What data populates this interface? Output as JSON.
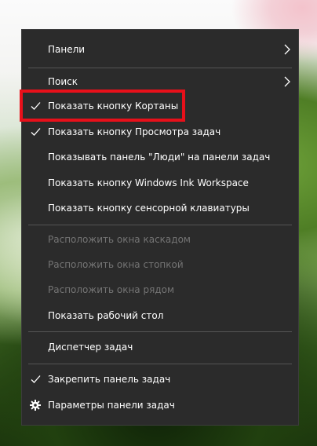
{
  "menu": {
    "items": [
      {
        "label": "Панели",
        "checked": false,
        "submenu": true,
        "disabled": false
      },
      {
        "label": "Поиск",
        "checked": false,
        "submenu": true,
        "disabled": false
      },
      {
        "label": "Показать кнопку Кортаны",
        "checked": true,
        "submenu": false,
        "disabled": false
      },
      {
        "label": "Показать кнопку Просмотра задач",
        "checked": true,
        "submenu": false,
        "disabled": false
      },
      {
        "label": "Показывать панель \"Люди\" на панели задач",
        "checked": false,
        "submenu": false,
        "disabled": false
      },
      {
        "label": "Показать кнопку Windows Ink Workspace",
        "checked": false,
        "submenu": false,
        "disabled": false
      },
      {
        "label": "Показать кнопку сенсорной клавиатуры",
        "checked": false,
        "submenu": false,
        "disabled": false
      },
      {
        "label": "Расположить окна каскадом",
        "checked": false,
        "submenu": false,
        "disabled": true
      },
      {
        "label": "Расположить окна стопкой",
        "checked": false,
        "submenu": false,
        "disabled": true
      },
      {
        "label": "Расположить окна рядом",
        "checked": false,
        "submenu": false,
        "disabled": true
      },
      {
        "label": "Показать рабочий стол",
        "checked": false,
        "submenu": false,
        "disabled": false
      },
      {
        "label": "Диспетчер задач",
        "checked": false,
        "submenu": false,
        "disabled": false
      },
      {
        "label": "Закрепить панель задач",
        "checked": true,
        "submenu": false,
        "disabled": false
      },
      {
        "label": "Параметры панели задач",
        "checked": false,
        "submenu": false,
        "disabled": false,
        "icon": "gear-icon"
      }
    ]
  },
  "colors": {
    "menu_background": "#2b2b2b",
    "text": "#ffffff",
    "disabled_text": "#747474",
    "separator": "#555555",
    "highlight_border": "#e8101a"
  }
}
